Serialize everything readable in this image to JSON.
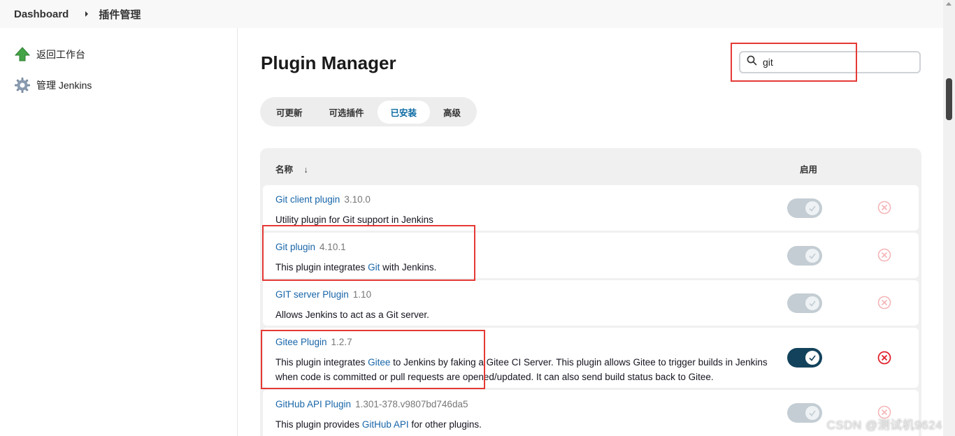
{
  "breadcrumb": {
    "home": "Dashboard",
    "current": "插件管理"
  },
  "sidebar": {
    "items": [
      {
        "label": "返回工作台",
        "icon": "up-arrow-icon"
      },
      {
        "label": "管理 Jenkins",
        "icon": "gear-icon"
      }
    ]
  },
  "page": {
    "title": "Plugin Manager"
  },
  "search": {
    "value": "git",
    "placeholder": ""
  },
  "tabs": [
    {
      "label": "可更新",
      "active": false
    },
    {
      "label": "可选插件",
      "active": false
    },
    {
      "label": "已安装",
      "active": true
    },
    {
      "label": "高级",
      "active": false
    }
  ],
  "table": {
    "col_name": "名称",
    "sort_indicator": "↓",
    "col_enabled": "启用",
    "rows": [
      {
        "name": "Git client plugin",
        "version": "3.10.0",
        "desc_parts": [
          "Utility plugin for Git support in Jenkins"
        ],
        "enabled": true,
        "can_toggle": false
      },
      {
        "name": "Git plugin",
        "version": "4.10.1",
        "desc_parts": [
          "This plugin integrates ",
          "Git",
          " with Jenkins."
        ],
        "enabled": true,
        "can_toggle": false
      },
      {
        "name": "GIT server Plugin",
        "version": "1.10",
        "desc_parts": [
          "Allows Jenkins to act as a Git server."
        ],
        "enabled": true,
        "can_toggle": false
      },
      {
        "name": "Gitee Plugin",
        "version": "1.2.7",
        "desc_parts": [
          "This plugin integrates ",
          "Gitee",
          " to Jenkins by faking a Gitee CI Server. This plugin allows Gitee to trigger builds in Jenkins when code is committed or pull requests are opened/updated. It can also send build status back to Gitee."
        ],
        "enabled": true,
        "can_toggle": true
      },
      {
        "name": "GitHub API Plugin",
        "version": "1.301-378.v9807bd746da5",
        "desc_parts": [
          "This plugin provides ",
          "GitHub API",
          " for other plugins."
        ],
        "enabled": true,
        "can_toggle": false
      }
    ]
  },
  "colors": {
    "link": "#1865a8",
    "toggle_on": "#13435c",
    "toggle_disabled": "#c3cdd3",
    "uninstall_active": "#e0202a",
    "uninstall_disabled": "#f5b5b8",
    "annotation": "#e53935"
  },
  "watermark": "CSDN @测试机9624"
}
